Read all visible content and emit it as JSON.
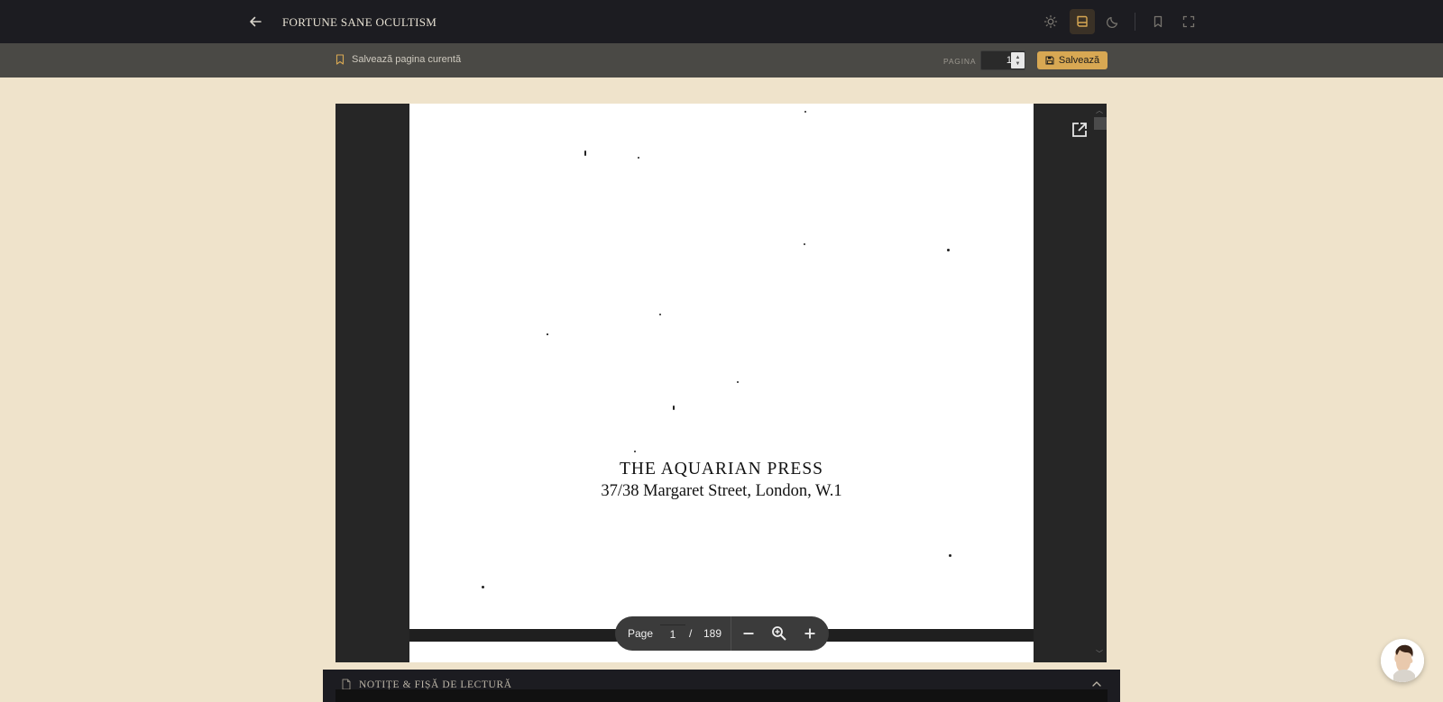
{
  "header": {
    "title": "FORTUNE SANE OCULTISM",
    "icons": [
      "back-arrow-icon",
      "sun-icon",
      "book-mode-icon",
      "moon-icon",
      "bookmark-icon",
      "fullscreen-icon"
    ],
    "active_color": "#d8a853"
  },
  "subbar": {
    "save_current_label": "Salvează pagina curentă",
    "page_label": "PAGINA",
    "page_value": "1",
    "save_button_label": "Salvează"
  },
  "pdf": {
    "publisher_line1": "THE AQUARIAN PRESS",
    "publisher_line2": "37/38 Margaret Street, London, W.1"
  },
  "pagebar": {
    "page_label": "Page",
    "current_page": "1",
    "separator": "/",
    "total_pages": "189"
  },
  "notes": {
    "title": "NOTIȚE & FIȘĂ DE LECTURĂ"
  },
  "colors": {
    "background": "#efe3cb",
    "topbar": "#1c1c21",
    "subbar": "#4a4945",
    "accent": "#d8a853"
  }
}
